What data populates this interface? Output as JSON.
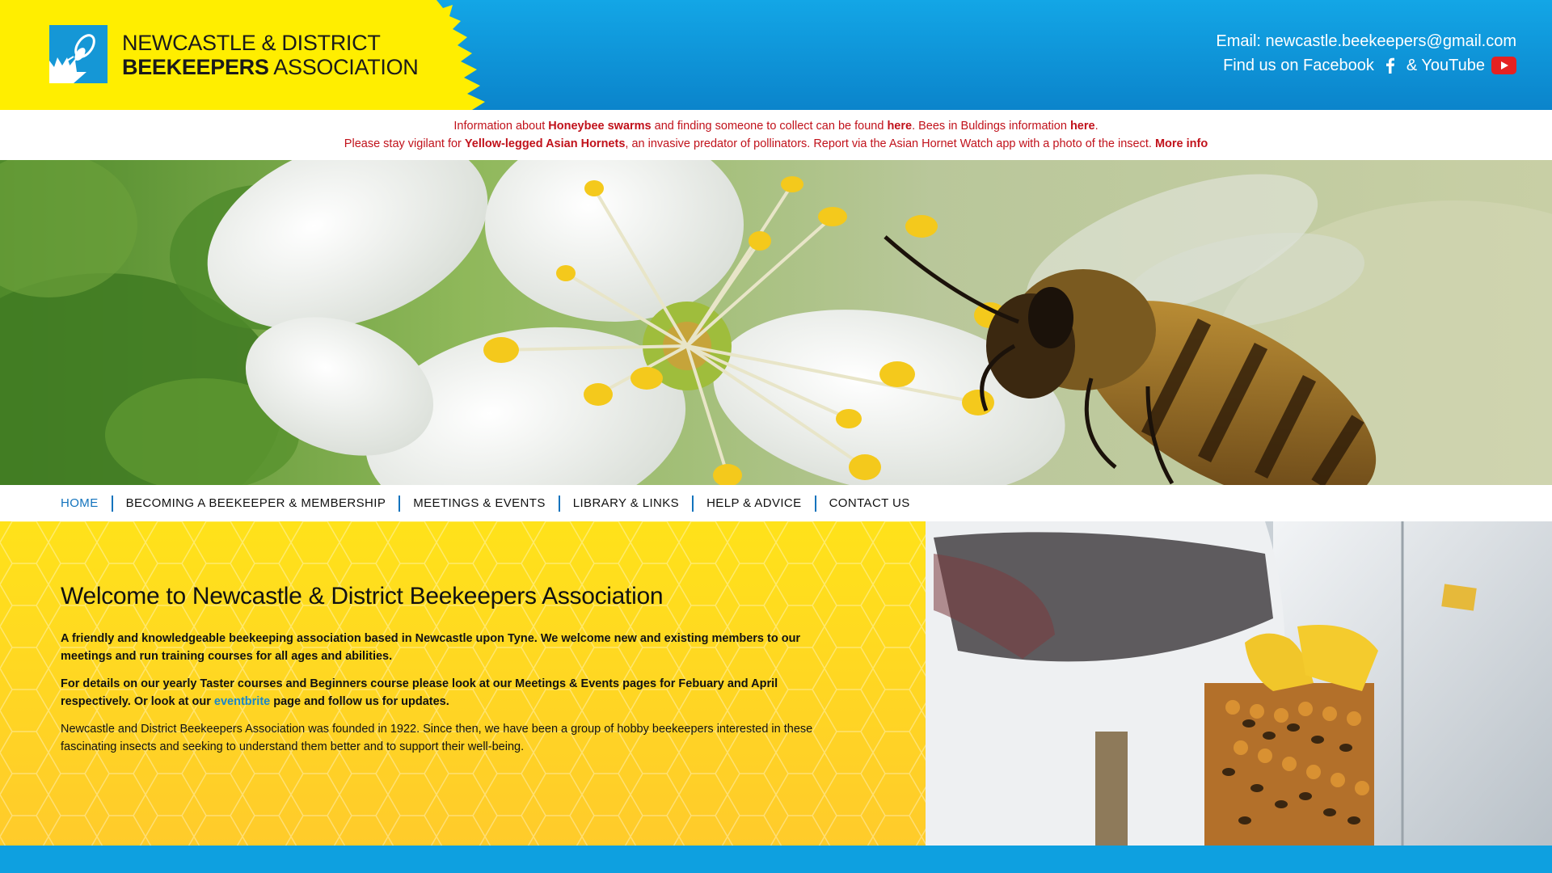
{
  "colors": {
    "header_blue": "#0b84cb",
    "logo_yellow": "#ffee00",
    "alert_red": "#c1121b",
    "nav_accent": "#1273bd"
  },
  "header": {
    "logo_line1": "NEWCASTLE & DISTRICT",
    "logo_line2_bold": "BEEKEEPERS",
    "logo_line2_rest": " ASSOCIATION",
    "email_label": "Email: newcastle.beekeepers@gmail.com",
    "find_us_label": "Find us on Facebook",
    "youtube_label": "& YouTube",
    "facebook_icon": "facebook-icon",
    "youtube_icon": "youtube-icon"
  },
  "notice": {
    "line1": {
      "pre": "Information about ",
      "swarms_link": "Honeybee swarms",
      "mid": " and finding someone to collect can be found ",
      "here1": "here",
      "mid2": ". Bees in Buldings information ",
      "here2": "here",
      "end": "."
    },
    "line2": {
      "pre": "Please stay vigilant for ",
      "hornets_link": "Yellow-legged Asian Hornets",
      "mid": ", an invasive predator of pollinators. Report via the Asian Hornet Watch app with a photo of the insect. ",
      "more_info": "More info"
    }
  },
  "nav": {
    "items": [
      {
        "label": "HOME"
      },
      {
        "label": "BECOMING A BEEKEEPER & MEMBERSHIP"
      },
      {
        "label": "MEETINGS & EVENTS"
      },
      {
        "label": "LIBRARY & LINKS"
      },
      {
        "label": "HELP & ADVICE"
      },
      {
        "label": "CONTACT US"
      }
    ]
  },
  "welcome": {
    "title": "Welcome to Newcastle & District Beekeepers Association",
    "p1": "A friendly and knowledgeable beekeeping association based in Newcastle upon Tyne. We welcome new and existing members to our meetings and run training courses for all ages and abilities.",
    "p2_pre": "For details on our yearly Taster courses and Beginners course please look at our Meetings & Events pages for Febuary and April respectively. Or look at our ",
    "p2_link": "eventbrite",
    "p2_post": " page and follow us for updates.",
    "p3": "Newcastle and District Beekeepers Association was founded in 1922. Since then, we have been a group of hobby beekeepers interested in these fascinating insects and seeking to understand them better and to support their well-being."
  }
}
